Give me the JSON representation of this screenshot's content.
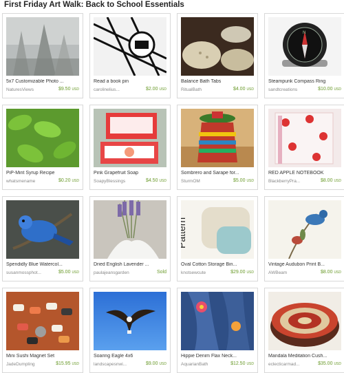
{
  "page": {
    "title": "First Friday Art Walk: Back to School Essentials"
  },
  "listings": [
    {
      "title": "5x7 Customizable Photo ...",
      "shop": "NaturesViews",
      "price": "$9.50",
      "currency": "USD",
      "image": "foggy-trees-photo"
    },
    {
      "title": "Read a book pin",
      "shop": "carolinelius...",
      "price": "$2.00",
      "currency": "USD",
      "image": "book-pin-print"
    },
    {
      "title": "Balance Bath Tabs",
      "shop": "RitualBath",
      "price": "$4.00",
      "currency": "USD",
      "image": "bath-tabs"
    },
    {
      "title": "Steampunk Compass Ring",
      "shop": "sandtcreations",
      "price": "$10.00",
      "currency": "USD",
      "image": "compass-ring"
    },
    {
      "title": "PiP-Mint Syrup Recipe",
      "shop": "whatsmename",
      "price": "$0.20",
      "currency": "USD",
      "image": "mint-leaves"
    },
    {
      "title": "Pink Grapefruit Soap",
      "shop": "SoapyBlessings",
      "price": "$4.50",
      "currency": "USD",
      "image": "grapefruit-soap"
    },
    {
      "title": "Sombrero and Sarape for...",
      "shop": "SturmOM",
      "price": "$5.00",
      "currency": "USD",
      "image": "sombrero-sarape"
    },
    {
      "title": "RED APPLE NOTEBOOK",
      "shop": "BlackberryPra...",
      "price": "$8.00",
      "currency": "USD",
      "image": "apple-notebook"
    },
    {
      "title": "Spendidly Blue Watercol...",
      "shop": "susanmossphot...",
      "price": "$5.00",
      "currency": "USD",
      "image": "blue-bird-watercolor"
    },
    {
      "title": "Dried English Lavender ...",
      "shop": "paulajeansgarden",
      "price": "Sold",
      "currency": "",
      "image": "lavender"
    },
    {
      "title": "Oval Cotton Storage Bin...",
      "shop": "knotsewcute",
      "price": "$29.00",
      "currency": "USD",
      "image": "storage-bins-pattern"
    },
    {
      "title": "Vintage Audubon Print B...",
      "shop": "AWBeam",
      "price": "$8.00",
      "currency": "USD",
      "image": "audubon-print"
    },
    {
      "title": "Mini Sushi Magnet Set",
      "shop": "JadeDumpling",
      "price": "$15.95",
      "currency": "USD",
      "image": "sushi-magnets"
    },
    {
      "title": "Soaring Eagle 4x6",
      "shop": "landscapesnwi...",
      "price": "$9.00",
      "currency": "USD",
      "image": "eagle-photo"
    },
    {
      "title": "Hippie Denim Flax Neck...",
      "shop": "AquarianBath",
      "price": "$12.50",
      "currency": "USD",
      "image": "denim-neck-wrap"
    },
    {
      "title": "Mandala Meditation Cush...",
      "shop": "eclecticarmad...",
      "price": "$35.00",
      "currency": "USD",
      "image": "mandala-cushion"
    }
  ]
}
